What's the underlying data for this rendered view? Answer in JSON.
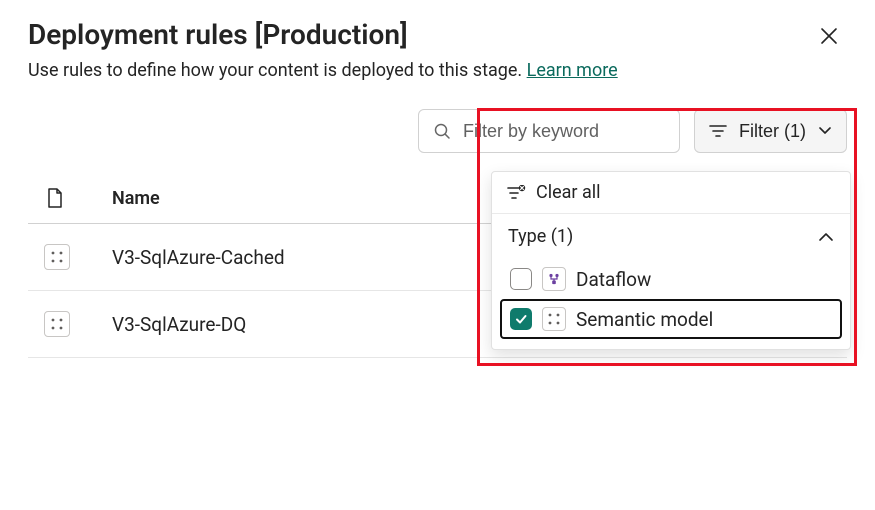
{
  "header": {
    "title": "Deployment rules [Production]",
    "subtitle": "Use rules to define how your content is deployed to this stage.",
    "learn_more": "Learn more"
  },
  "toolbar": {
    "search_placeholder": "Filter by keyword",
    "filter_button": "Filter (1)"
  },
  "table": {
    "columns": {
      "name": "Name"
    },
    "rows": [
      {
        "name": "V3-SqlAzure-Cached"
      },
      {
        "name": "V3-SqlAzure-DQ"
      }
    ]
  },
  "filter_panel": {
    "clear_all": "Clear all",
    "section_label": "Type (1)",
    "options": [
      {
        "label": "Dataflow",
        "checked": false
      },
      {
        "label": "Semantic model",
        "checked": true
      }
    ]
  },
  "colors": {
    "accent_teal": "#0f7b6c",
    "highlight_red": "#e81123"
  }
}
